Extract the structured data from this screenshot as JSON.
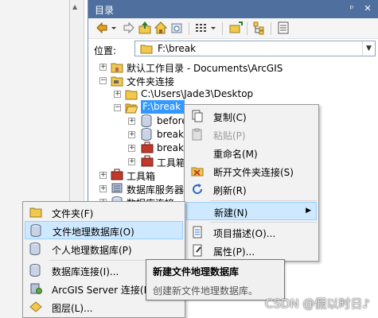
{
  "catalog": {
    "title": "目录",
    "title_buttons": [
      "pin-icon",
      "close-icon"
    ],
    "location_label": "位置:",
    "location_value": "F:\\break"
  },
  "toolbar": {
    "icons": [
      "back-arrow-icon",
      "dropdown-icon",
      "forward-arrow-icon",
      "up-folder-icon",
      "home-icon",
      "refresh-folder-icon",
      "view-list-icon",
      "dropdown-icon",
      "connect-folder-icon",
      "tree-view-icon",
      "options-icon"
    ]
  },
  "tree": {
    "items": [
      {
        "label": "默认工作目录 - Documents\\ArcGIS",
        "icon": "folder-home-icon"
      },
      {
        "label": "文件夹连接",
        "icon": "folder-connection-icon"
      },
      {
        "label": "C:\\Users\\Jade3\\Desktop",
        "icon": "folder-icon"
      },
      {
        "label": "F:\\break",
        "icon": "folder-open-icon"
      },
      {
        "label": "before",
        "icon": "database-icon"
      },
      {
        "label": "break",
        "icon": "database-icon"
      },
      {
        "label": "break",
        "icon": "toolbox-icon"
      },
      {
        "label": "工具箱",
        "icon": "toolbox-icon"
      },
      {
        "label": "工具箱",
        "icon": "toolbox-icon"
      },
      {
        "label": "数据库服务器",
        "icon": "database-server-icon"
      },
      {
        "label": "数据库连接",
        "icon": "database-connection-icon"
      }
    ]
  },
  "context_menu": {
    "items": [
      {
        "label": "复制(C)",
        "icon": "copy-icon",
        "disabled": false
      },
      {
        "label": "粘贴(P)",
        "icon": "paste-icon",
        "disabled": true
      },
      {
        "label": "重命名(M)",
        "icon": "",
        "disabled": false
      },
      {
        "label": "断开文件夹连接(S)",
        "icon": "disconnect-folder-icon",
        "disabled": false
      },
      {
        "label": "刷新(R)",
        "icon": "refresh-icon",
        "disabled": false
      },
      {
        "label": "新建(N)",
        "icon": "",
        "disabled": false,
        "submenu": true,
        "highlighted": true
      },
      {
        "label": "项目描述(O)...",
        "icon": "item-description-icon",
        "disabled": false
      },
      {
        "label": "属性(P)...",
        "icon": "properties-icon",
        "disabled": false
      }
    ]
  },
  "submenu": {
    "items": [
      {
        "label": "文件夹(F)",
        "icon": "folder-icon"
      },
      {
        "label": "文件地理数据库(O)",
        "icon": "file-geodatabase-icon",
        "highlighted": true
      },
      {
        "label": "个人地理数据库(P)",
        "icon": "personal-geodatabase-icon"
      },
      {
        "label": "数据库连接(I)...",
        "icon": "database-connection-icon"
      },
      {
        "label": "ArcGIS Server 连接(R)...",
        "icon": "arcgis-server-icon"
      },
      {
        "label": "图层(L)...",
        "icon": "layer-icon"
      }
    ]
  },
  "tooltip": {
    "title": "新建文件地理数据库",
    "description": "创建新文件地理数据库。"
  },
  "watermark": "CSDN @假以时日♪",
  "colors": {
    "title_bar": "#4f6f9f",
    "selection": "#3399ff",
    "menu_highlight": "#cde8ff",
    "menu_background": "#f2f2f2"
  }
}
